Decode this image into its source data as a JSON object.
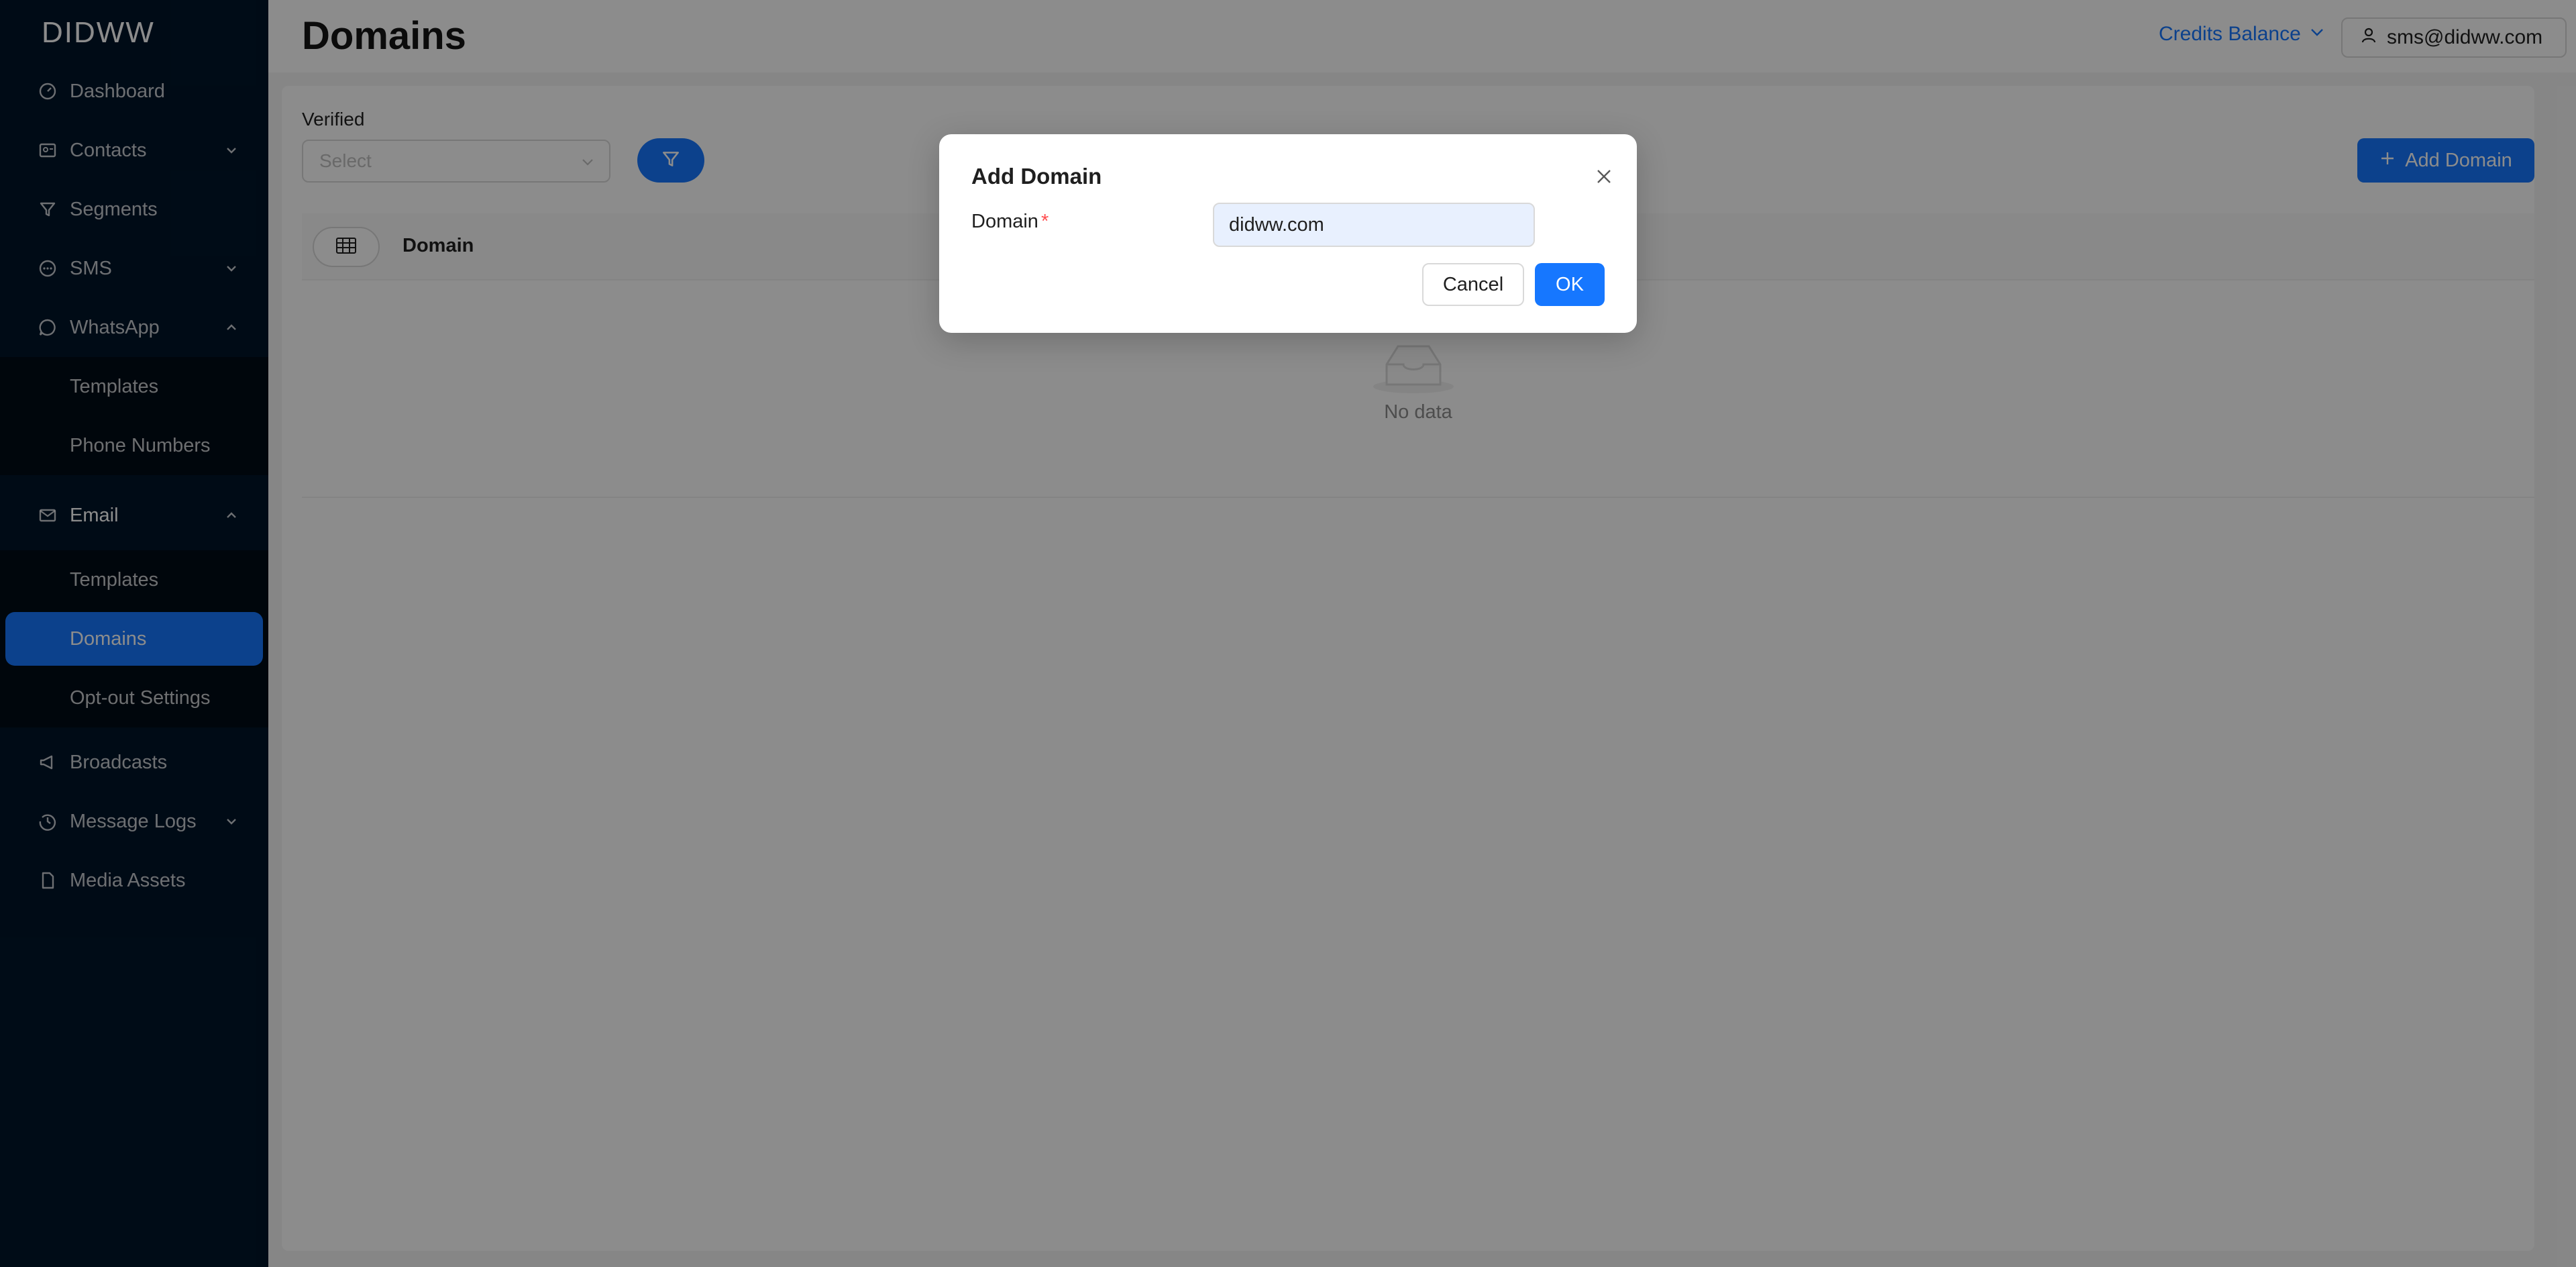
{
  "brand": {
    "logo_text": "DIDWW"
  },
  "sidebar": {
    "items": [
      {
        "label": "Dashboard",
        "icon": "dashboard-icon"
      },
      {
        "label": "Contacts",
        "icon": "contacts-icon",
        "expanded": false
      },
      {
        "label": "Segments",
        "icon": "filter-icon"
      },
      {
        "label": "SMS",
        "icon": "message-icon",
        "expanded": false
      },
      {
        "label": "WhatsApp",
        "icon": "whatsapp-icon",
        "expanded": true,
        "children": [
          {
            "label": "Templates"
          },
          {
            "label": "Phone Numbers"
          }
        ]
      },
      {
        "label": "Email",
        "icon": "mail-icon",
        "expanded": true,
        "children": [
          {
            "label": "Templates"
          },
          {
            "label": "Domains",
            "active": true
          },
          {
            "label": "Opt-out Settings"
          }
        ]
      },
      {
        "label": "Broadcasts",
        "icon": "megaphone-icon"
      },
      {
        "label": "Message Logs",
        "icon": "history-icon",
        "expanded": false
      },
      {
        "label": "Media Assets",
        "icon": "file-icon"
      }
    ]
  },
  "header": {
    "title": "Domains",
    "credits_label": "Credits Balance",
    "user_email": "sms@didww.com"
  },
  "filters": {
    "verified_label": "Verified",
    "verified_placeholder": "Select"
  },
  "toolbar": {
    "add_label": "Add Domain"
  },
  "table": {
    "columns": [
      "Domain"
    ],
    "rows": [],
    "empty_text": "No data"
  },
  "modal": {
    "title": "Add Domain",
    "field_label": "Domain",
    "field_value": "didww.com",
    "cancel_label": "Cancel",
    "ok_label": "OK"
  },
  "colors": {
    "sidebar_bg": "#001529",
    "primary": "#1677ff",
    "required": "#ff4d4f"
  }
}
